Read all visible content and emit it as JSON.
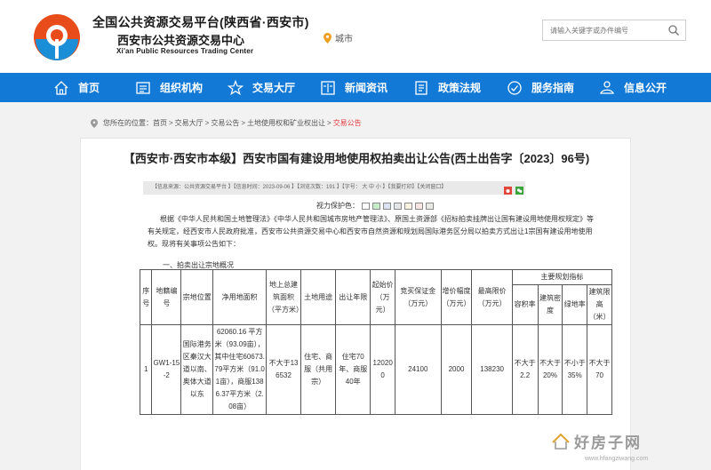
{
  "header": {
    "title_cn": "全国公共资源交易平台(陕西省·西安市)",
    "subtitle_cn": "西安市公共资源交易中心",
    "title_en": "Xi'an Public Resources Trading Center",
    "city_label": "城市",
    "search_placeholder": "请输入关键字或办件编号"
  },
  "nav": {
    "items": [
      {
        "label": "首页",
        "icon": "home-icon"
      },
      {
        "label": "组织机构",
        "icon": "org-icon"
      },
      {
        "label": "交易大厅",
        "icon": "star-icon"
      },
      {
        "label": "新闻资讯",
        "icon": "news-icon"
      },
      {
        "label": "政策法规",
        "icon": "policy-icon"
      },
      {
        "label": "服务指南",
        "icon": "service-icon"
      },
      {
        "label": "信息公开",
        "icon": "info-icon"
      }
    ]
  },
  "breadcrumb": {
    "prefix": "您所在的位置：",
    "items": [
      "首页",
      "交易大厅",
      "交易公告",
      "土地使用权和矿业权出让"
    ],
    "current": "交易公告"
  },
  "article": {
    "title": "【西安市·西安市本级】西安市国有建设用地使用权拍卖出让公告(西土出告字〔2023〕96号)",
    "meta": "【信息来源：公共资源交易平台 】【信息时间：2023-09-06 】【浏览次数：191 】【字号： 大 中 小 】【我要打印】【关闭窗口】",
    "color_label": "视力保护色：",
    "paragraph": "根据《中华人民共和国土地管理法》《中华人民共和国城市房地产管理法》、原国土资源部《招标拍卖挂牌出让国有建设用地使用权规定》等有关规定，经西安市人民政府批准，西安市公共资源交易中心和西安市自然资源和规划局国际港务区分局以拍卖方式出让1宗国有建设用地使用权。现将有关事项公告如下：",
    "section": "一、拍卖出让宗地概况"
  },
  "table": {
    "headers": {
      "seq": "序号",
      "parcel_no": "地籍编号",
      "location": "宗地位置",
      "net_area": "净用地面积",
      "building_area": "地上总建筑面积（平方米）",
      "land_use": "土地用途",
      "term": "出让年限",
      "start_price": "起始价（万元）",
      "deposit": "竞买保证金（万元）",
      "increment": "增价幅度（万元）",
      "max_price": "最高限价（万元）",
      "planning_group": "主要规划指标",
      "far": "容积率",
      "density": "建筑密度",
      "green": "绿地率",
      "height": "建筑限高（米）"
    },
    "row": {
      "seq": "1",
      "parcel_no": "GW1-15-2",
      "location": "国际港务区秦汉大道以南、奥体大道以东",
      "net_area": "62060.16 平方米（93.09亩），其中住宅60673.79平方米（91.01亩），商服1386.37平方米（2.08亩）",
      "building_area": "不大于136532",
      "land_use": "住宅、商服（共用宗）",
      "term": "住宅70年、商服40年",
      "start_price": "120200",
      "deposit": "24100",
      "increment": "2000",
      "max_price": "138230",
      "far": "不大于2.2",
      "density": "不大于20%",
      "green": "不小于35%",
      "height": "不大于70"
    }
  },
  "watermark": {
    "text": "好房子网",
    "url": "www.hfangziwang.com"
  },
  "colors": {
    "nav_blue": "#1279d6",
    "highlight_red": "#e4393c"
  }
}
